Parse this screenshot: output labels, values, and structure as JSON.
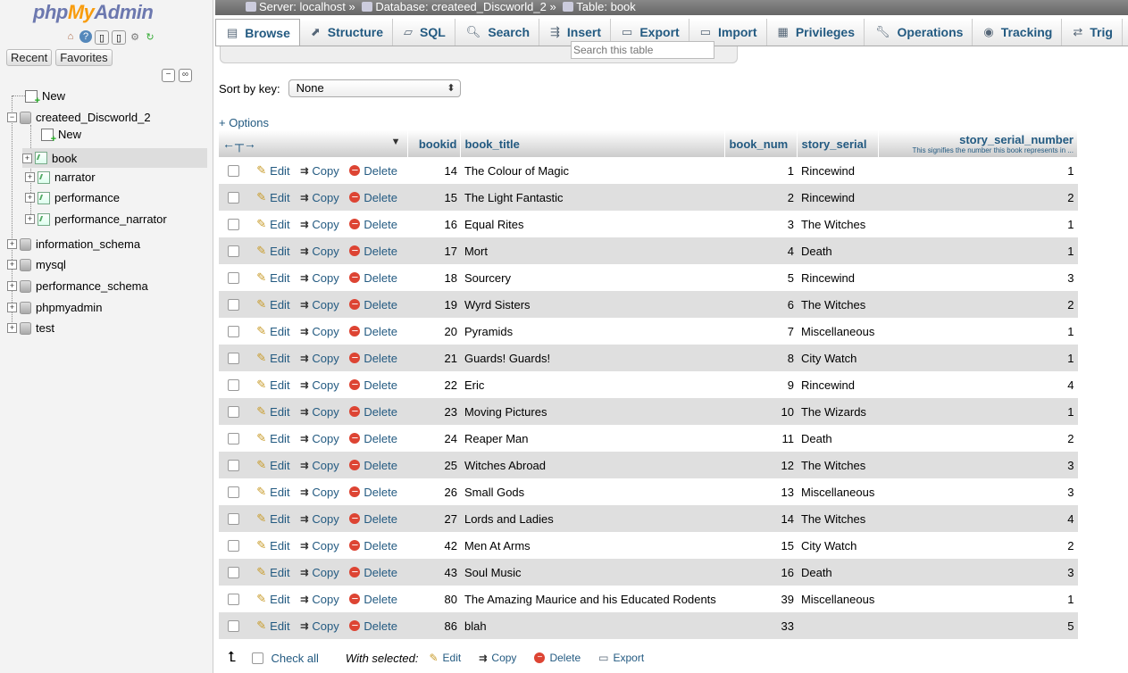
{
  "logo": {
    "php": "php",
    "my": "My",
    "admin": "Admin"
  },
  "nav": {
    "recent": "Recent",
    "favorites": "Favorites",
    "new_top": "New",
    "db_current": "createed_Discworld_2",
    "new_sub": "New",
    "tables": [
      "book",
      "narrator",
      "performance",
      "performance_narrator"
    ],
    "other_dbs": [
      "information_schema",
      "mysql",
      "performance_schema",
      "phpmyadmin",
      "test"
    ]
  },
  "breadcrumb": {
    "server": "Server: localhost",
    "sep": "»",
    "database": "Database: createed_Discworld_2",
    "table": "Table: book"
  },
  "tabs": [
    {
      "label": "Browse",
      "icon": "browse-icon"
    },
    {
      "label": "Structure",
      "icon": "structure-icon"
    },
    {
      "label": "SQL",
      "icon": "sql-icon"
    },
    {
      "label": "Search",
      "icon": "search-icon"
    },
    {
      "label": "Insert",
      "icon": "insert-icon"
    },
    {
      "label": "Export",
      "icon": "export-icon"
    },
    {
      "label": "Import",
      "icon": "import-icon"
    },
    {
      "label": "Privileges",
      "icon": "privileges-icon"
    },
    {
      "label": "Operations",
      "icon": "wrench-icon"
    },
    {
      "label": "Tracking",
      "icon": "eye-icon"
    },
    {
      "label": "Trig",
      "icon": "triggers-icon"
    }
  ],
  "filter": {
    "placeholder": "Search this table"
  },
  "sort": {
    "label": "Sort by key:",
    "value": "None"
  },
  "options_link": "+ Options",
  "columns": {
    "bookid": "bookid",
    "book_title": "book_title",
    "book_num": "book_num",
    "story_serial": "story_serial",
    "story_serial_number": "story_serial_number",
    "story_serial_number_comment": "This signifies the number this book represents in ..."
  },
  "actions": {
    "edit": "Edit",
    "copy": "Copy",
    "delete": "Delete"
  },
  "rows": [
    {
      "bookid": "14",
      "book_title": "The Colour of Magic",
      "book_num": "1",
      "story_serial": "Rincewind",
      "story_serial_number": "1"
    },
    {
      "bookid": "15",
      "book_title": "The Light Fantastic",
      "book_num": "2",
      "story_serial": "Rincewind",
      "story_serial_number": "2"
    },
    {
      "bookid": "16",
      "book_title": "Equal Rites",
      "book_num": "3",
      "story_serial": "The Witches",
      "story_serial_number": "1"
    },
    {
      "bookid": "17",
      "book_title": "Mort",
      "book_num": "4",
      "story_serial": "Death",
      "story_serial_number": "1"
    },
    {
      "bookid": "18",
      "book_title": "Sourcery",
      "book_num": "5",
      "story_serial": "Rincewind",
      "story_serial_number": "3"
    },
    {
      "bookid": "19",
      "book_title": "Wyrd Sisters",
      "book_num": "6",
      "story_serial": "The Witches",
      "story_serial_number": "2"
    },
    {
      "bookid": "20",
      "book_title": "Pyramids",
      "book_num": "7",
      "story_serial": "Miscellaneous",
      "story_serial_number": "1"
    },
    {
      "bookid": "21",
      "book_title": "Guards! Guards!",
      "book_num": "8",
      "story_serial": "City Watch",
      "story_serial_number": "1"
    },
    {
      "bookid": "22",
      "book_title": "Eric",
      "book_num": "9",
      "story_serial": "Rincewind",
      "story_serial_number": "4"
    },
    {
      "bookid": "23",
      "book_title": "Moving Pictures",
      "book_num": "10",
      "story_serial": "The Wizards",
      "story_serial_number": "1"
    },
    {
      "bookid": "24",
      "book_title": "Reaper Man",
      "book_num": "11",
      "story_serial": "Death",
      "story_serial_number": "2"
    },
    {
      "bookid": "25",
      "book_title": "Witches Abroad",
      "book_num": "12",
      "story_serial": "The Witches",
      "story_serial_number": "3"
    },
    {
      "bookid": "26",
      "book_title": "Small Gods",
      "book_num": "13",
      "story_serial": "Miscellaneous",
      "story_serial_number": "3"
    },
    {
      "bookid": "27",
      "book_title": "Lords and Ladies",
      "book_num": "14",
      "story_serial": "The Witches",
      "story_serial_number": "4"
    },
    {
      "bookid": "42",
      "book_title": "Men At Arms",
      "book_num": "15",
      "story_serial": "City Watch",
      "story_serial_number": "2"
    },
    {
      "bookid": "43",
      "book_title": "Soul Music",
      "book_num": "16",
      "story_serial": "Death",
      "story_serial_number": "3"
    },
    {
      "bookid": "80",
      "book_title": "The Amazing Maurice and his Educated Rodents",
      "book_num": "39",
      "story_serial": "Miscellaneous",
      "story_serial_number": "1"
    },
    {
      "bookid": "86",
      "book_title": "blah",
      "book_num": "33",
      "story_serial": "",
      "story_serial_number": "5"
    }
  ],
  "bottom": {
    "check_all": "Check all",
    "with_selected": "With selected:",
    "edit": "Edit",
    "copy": "Copy",
    "delete": "Delete",
    "export": "Export"
  },
  "colors": {
    "link": "#235a81",
    "row_even": "#dfdfdf",
    "logo_orange": "#f89c0e",
    "logo_blue": "#6c78af"
  }
}
